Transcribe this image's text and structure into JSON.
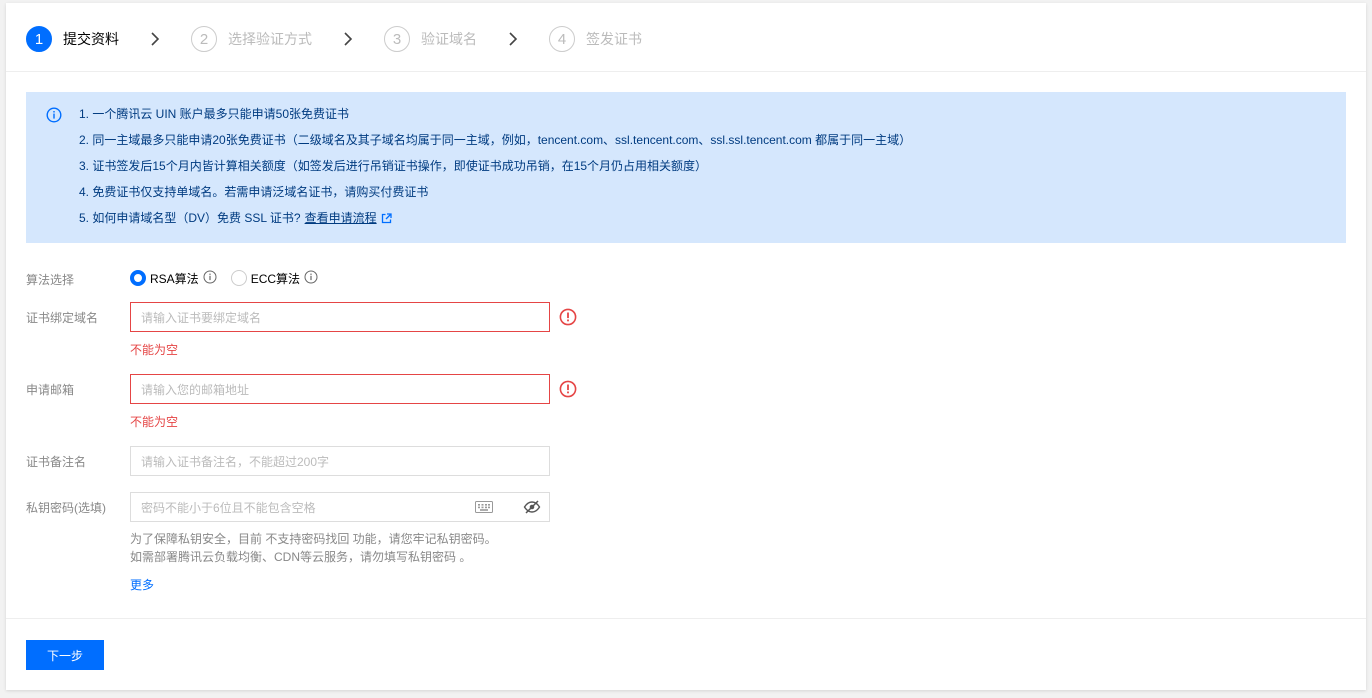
{
  "steps": [
    {
      "num": "1",
      "label": "提交资料",
      "active": true
    },
    {
      "num": "2",
      "label": "选择验证方式",
      "active": false
    },
    {
      "num": "3",
      "label": "验证域名",
      "active": false
    },
    {
      "num": "4",
      "label": "签发证书",
      "active": false
    }
  ],
  "notice": {
    "lines": [
      "1. 一个腾讯云 UIN 账户最多只能申请50张免费证书",
      "2. 同一主域最多只能申请20张免费证书（二级域名及其子域名均属于同一主域，例如，tencent.com、ssl.tencent.com、ssl.ssl.tencent.com 都属于同一主域）",
      "3. 证书签发后15个月内皆计算相关额度（如签发后进行吊销证书操作，即使证书成功吊销，在15个月仍占用相关额度）",
      "4. 免费证书仅支持单域名。若需申请泛域名证书，请购买付费证书",
      "5. 如何申请域名型（DV）免费 SSL 证书?"
    ],
    "link_text": "查看申请流程"
  },
  "form": {
    "algorithm": {
      "label": "算法选择",
      "options": [
        {
          "label": "RSA算法",
          "checked": true
        },
        {
          "label": "ECC算法",
          "checked": false
        }
      ]
    },
    "domain": {
      "label": "证书绑定域名",
      "placeholder": "请输入证书要绑定域名",
      "error": "不能为空"
    },
    "email": {
      "label": "申请邮箱",
      "placeholder": "请输入您的邮箱地址",
      "error": "不能为空"
    },
    "remark": {
      "label": "证书备注名",
      "placeholder": "请输入证书备注名，不能超过200字"
    },
    "password": {
      "label": "私钥密码(选填)",
      "placeholder": "密码不能小于6位且不能包含空格",
      "help_line1": "为了保障私钥安全，目前 不支持密码找回 功能，请您牢记私钥密码。",
      "help_line2": "如需部署腾讯云负载均衡、CDN等云服务，请勿填写私钥密码 。",
      "more": "更多"
    }
  },
  "next_button": "下一步",
  "colors": {
    "primary": "#006eff",
    "error": "#e54545",
    "notice_bg": "#d5e7fd",
    "notice_text": "#003b80"
  }
}
